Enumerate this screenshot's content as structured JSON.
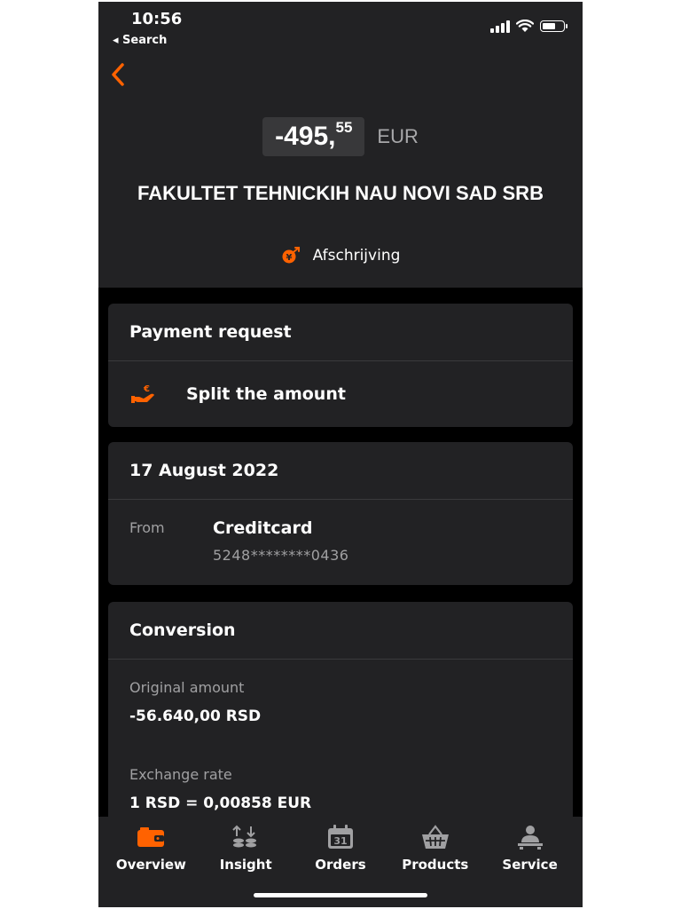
{
  "status_bar": {
    "time": "10:56",
    "back_app": "◂ Search"
  },
  "transaction": {
    "amount_main": "-495,",
    "amount_cents": "55",
    "currency": "EUR",
    "merchant": "FAKULTET TEHNICKIH NAU NOVI SAD SRB",
    "type": "Afschrijving"
  },
  "payment_request": {
    "title": "Payment request",
    "split_label": "Split the amount"
  },
  "details": {
    "date": "17 August 2022",
    "from_label": "From",
    "from_value": "Creditcard",
    "card_number": "5248********0436"
  },
  "conversion": {
    "title": "Conversion",
    "original_label": "Original amount",
    "original_value": "-56.640,00 RSD",
    "rate_label": "Exchange rate",
    "rate_value": "1 RSD = 0,00858 EUR"
  },
  "tabs": [
    {
      "label": "Overview",
      "icon": "wallet-icon",
      "active": true
    },
    {
      "label": "Insight",
      "icon": "arrows-coins-icon",
      "active": false
    },
    {
      "label": "Orders",
      "icon": "calendar-icon",
      "active": false
    },
    {
      "label": "Products",
      "icon": "basket-icon",
      "active": false
    },
    {
      "label": "Service",
      "icon": "service-person-icon",
      "active": false
    }
  ],
  "colors": {
    "accent": "#ff6200",
    "background": "#000000",
    "card": "#222224",
    "muted_text": "#a0a0a2"
  }
}
